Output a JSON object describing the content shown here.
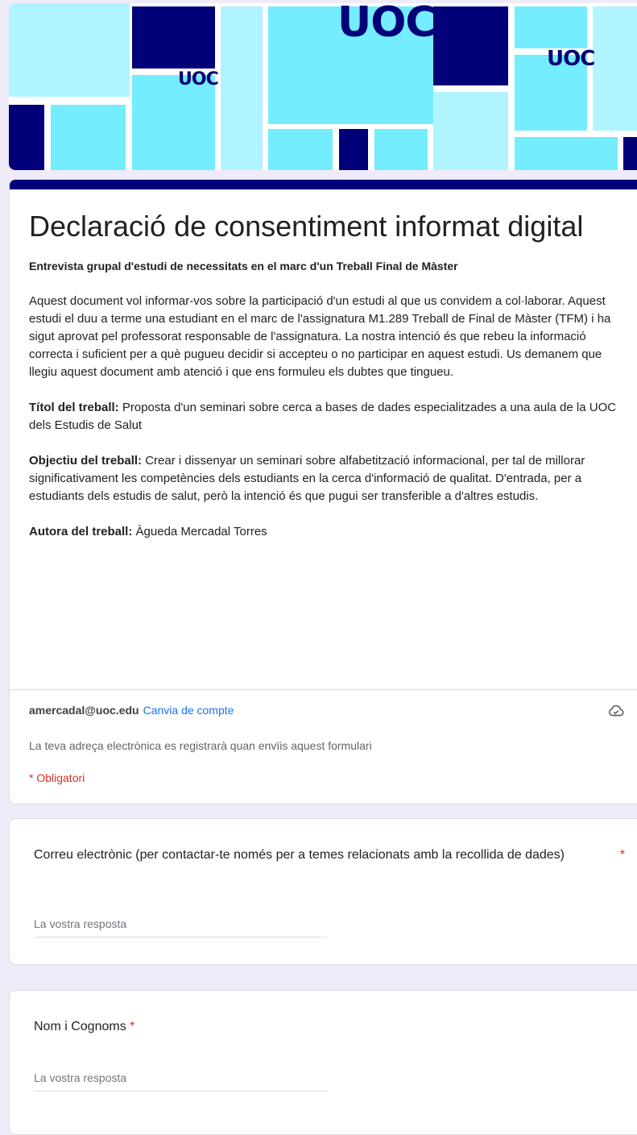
{
  "banner": {
    "logo_large": "UOC",
    "logo_small": "UOC",
    "colors": {
      "navy": "#000078",
      "cyan": "#73edff",
      "light_cyan": "#b0f4ff"
    }
  },
  "form": {
    "title": "Declaració de consentiment informat digital",
    "subheading": "Entrevista grupal d'estudi de necessitats en el marc d'un Treball Final de Màster",
    "intro": "Aquest document vol informar-vos sobre la participació d'un estudi al que us convidem a col·laborar. Aquest estudi el duu a terme una estudiant en el marc de l'assignatura M1.289 Treball de Final de Màster (TFM) i ha sigut aprovat pel professorat responsable de l'assignatura. La nostra intenció és que rebeu la informació correcta i suficient per a què pugueu decidir si accepteu o no participar en aquest estudi. Us demanem que llegiu aquest document amb atenció i que ens formuleu els dubtes que tingueu.",
    "title_label": "Títol del treball:",
    "title_value": "Proposta d'un seminari sobre cerca a bases de dades especialitzades a una aula de la UOC dels Estudis de Salut",
    "objective_label": "Objectiu del treball:",
    "objective_value": "Crear i dissenyar un seminari sobre alfabetització informacional, per tal de millorar  significativament les competències dels estudiants en la cerca d'informació de qualitat. D'entrada, per a estudiants dels estudis de salut, però la intenció és que pugui ser transferible a d'altres estudis.",
    "author_label": "Autora del treball:",
    "author_value": "Àgueda Mercadal Torres"
  },
  "account": {
    "email": "amercadal@uoc.edu",
    "switch_label": "Canvia de compte",
    "record_note": "La teva adreça electrònica es registrarà quan envïis aquest formulari",
    "required_note": "* Obligatori"
  },
  "questions": [
    {
      "title": "Correu electrònic (per contactar-te només per a temes relacionats amb la recollida de dades)",
      "required_mark": "*",
      "placeholder": "La vostra resposta"
    },
    {
      "title": "Nom i Cognoms",
      "required_mark": "*",
      "placeholder": "La vostra resposta"
    }
  ]
}
